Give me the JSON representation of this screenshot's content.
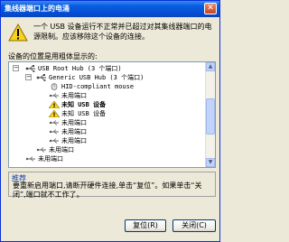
{
  "window": {
    "title": "集线器端口上的电涌",
    "close_glyph": "✕"
  },
  "warning": {
    "icon": "warning-triangle-icon",
    "text": "一个 USB 设备运行不正常并已超过对其集线器端口的电源限制。应该移除这个设备的连接。"
  },
  "location_label": "设备的位置是用粗体显示的:",
  "tree": {
    "rows": [
      {
        "label": "USB Root Hub (3 个端口)",
        "icon": "usb-hub-icon",
        "bold": false
      },
      {
        "label": "Generic USB Hub (3 个端口)",
        "icon": "usb-hub-icon",
        "bold": false
      },
      {
        "label": "HID-compliant mouse",
        "icon": "mouse-icon",
        "bold": false
      },
      {
        "label": "未用端口",
        "icon": "usb-port-icon",
        "bold": false
      },
      {
        "label": "未知 USB 设备",
        "icon": "warning-device-icon",
        "bold": true
      },
      {
        "label": "未知 USB 设备",
        "icon": "warning-device-icon",
        "bold": false
      },
      {
        "label": "未用端口",
        "icon": "usb-port-icon",
        "bold": false
      },
      {
        "label": "未用端口",
        "icon": "usb-port-icon",
        "bold": false
      },
      {
        "label": "未用端口",
        "icon": "usb-port-icon",
        "bold": false
      },
      {
        "label": "未用端口",
        "icon": "usb-port-icon",
        "bold": false
      },
      {
        "label": "未用端口",
        "icon": "usb-port-icon",
        "bold": false
      }
    ],
    "expander_minus": "−"
  },
  "hint": {
    "title": "推荐",
    "body": "要重新启用端口,请断开硬件连接,单击“复位”。如果单击“关闭”,端口就不工作了。"
  },
  "buttons": {
    "restore": "复位(R)",
    "close": "关闭(C)"
  },
  "scrollbar": {
    "up_glyph": "▲",
    "down_glyph": "▼"
  }
}
